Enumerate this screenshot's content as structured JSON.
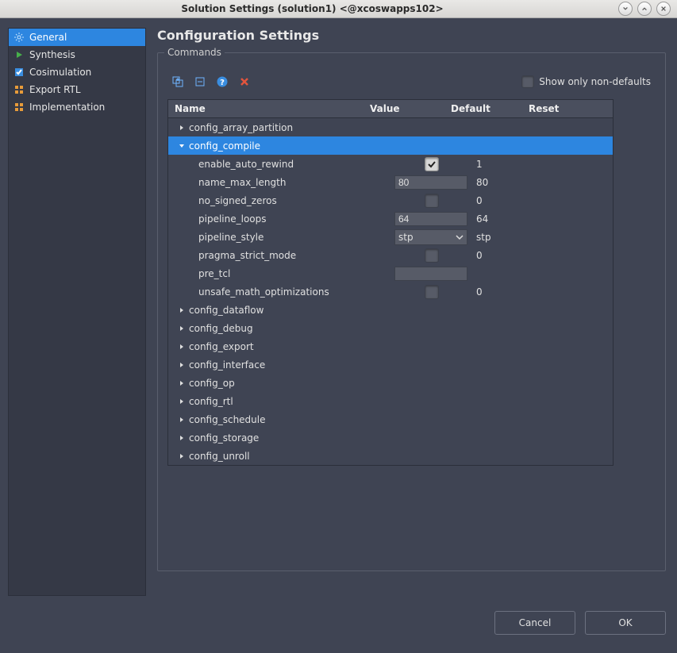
{
  "titlebar": {
    "title": "Solution Settings (solution1)  <@xcoswapps102>"
  },
  "sidebar": {
    "items": [
      {
        "label": "General",
        "selected": true,
        "icon": "gear-icon"
      },
      {
        "label": "Synthesis",
        "selected": false,
        "icon": "play-icon"
      },
      {
        "label": "Cosimulation",
        "selected": false,
        "icon": "check-icon"
      },
      {
        "label": "Export RTL",
        "selected": false,
        "icon": "grid-icon"
      },
      {
        "label": "Implementation",
        "selected": false,
        "icon": "grid-icon"
      }
    ]
  },
  "page": {
    "title": "Configuration Settings",
    "group_label": "Commands",
    "show_only_non_defaults_label": "Show only non-defaults",
    "show_only_non_defaults_checked": false
  },
  "grid": {
    "headers": {
      "name": "Name",
      "value": "Value",
      "default": "Default",
      "reset": "Reset"
    },
    "rows": [
      {
        "kind": "parent",
        "name": "config_array_partition",
        "expanded": false,
        "selected": false
      },
      {
        "kind": "parent",
        "name": "config_compile",
        "expanded": true,
        "selected": true
      },
      {
        "kind": "child",
        "name": "enable_auto_rewind",
        "value_type": "checkbox",
        "value": true,
        "default": "1"
      },
      {
        "kind": "child",
        "name": "name_max_length",
        "value_type": "text",
        "value": "80",
        "default": "80"
      },
      {
        "kind": "child",
        "name": "no_signed_zeros",
        "value_type": "checkbox",
        "value": false,
        "default": "0"
      },
      {
        "kind": "child",
        "name": "pipeline_loops",
        "value_type": "text",
        "value": "64",
        "default": "64"
      },
      {
        "kind": "child",
        "name": "pipeline_style",
        "value_type": "select",
        "value": "stp",
        "default": "stp"
      },
      {
        "kind": "child",
        "name": "pragma_strict_mode",
        "value_type": "checkbox",
        "value": false,
        "default": "0"
      },
      {
        "kind": "child",
        "name": "pre_tcl",
        "value_type": "text",
        "value": "",
        "default": ""
      },
      {
        "kind": "child",
        "name": "unsafe_math_optimizations",
        "value_type": "checkbox",
        "value": false,
        "default": "0"
      },
      {
        "kind": "parent",
        "name": "config_dataflow",
        "expanded": false,
        "selected": false
      },
      {
        "kind": "parent",
        "name": "config_debug",
        "expanded": false,
        "selected": false
      },
      {
        "kind": "parent",
        "name": "config_export",
        "expanded": false,
        "selected": false
      },
      {
        "kind": "parent",
        "name": "config_interface",
        "expanded": false,
        "selected": false
      },
      {
        "kind": "parent",
        "name": "config_op",
        "expanded": false,
        "selected": false
      },
      {
        "kind": "parent",
        "name": "config_rtl",
        "expanded": false,
        "selected": false
      },
      {
        "kind": "parent",
        "name": "config_schedule",
        "expanded": false,
        "selected": false
      },
      {
        "kind": "parent",
        "name": "config_storage",
        "expanded": false,
        "selected": false
      },
      {
        "kind": "parent",
        "name": "config_unroll",
        "expanded": false,
        "selected": false
      }
    ]
  },
  "footer": {
    "cancel": "Cancel",
    "ok": "OK"
  }
}
